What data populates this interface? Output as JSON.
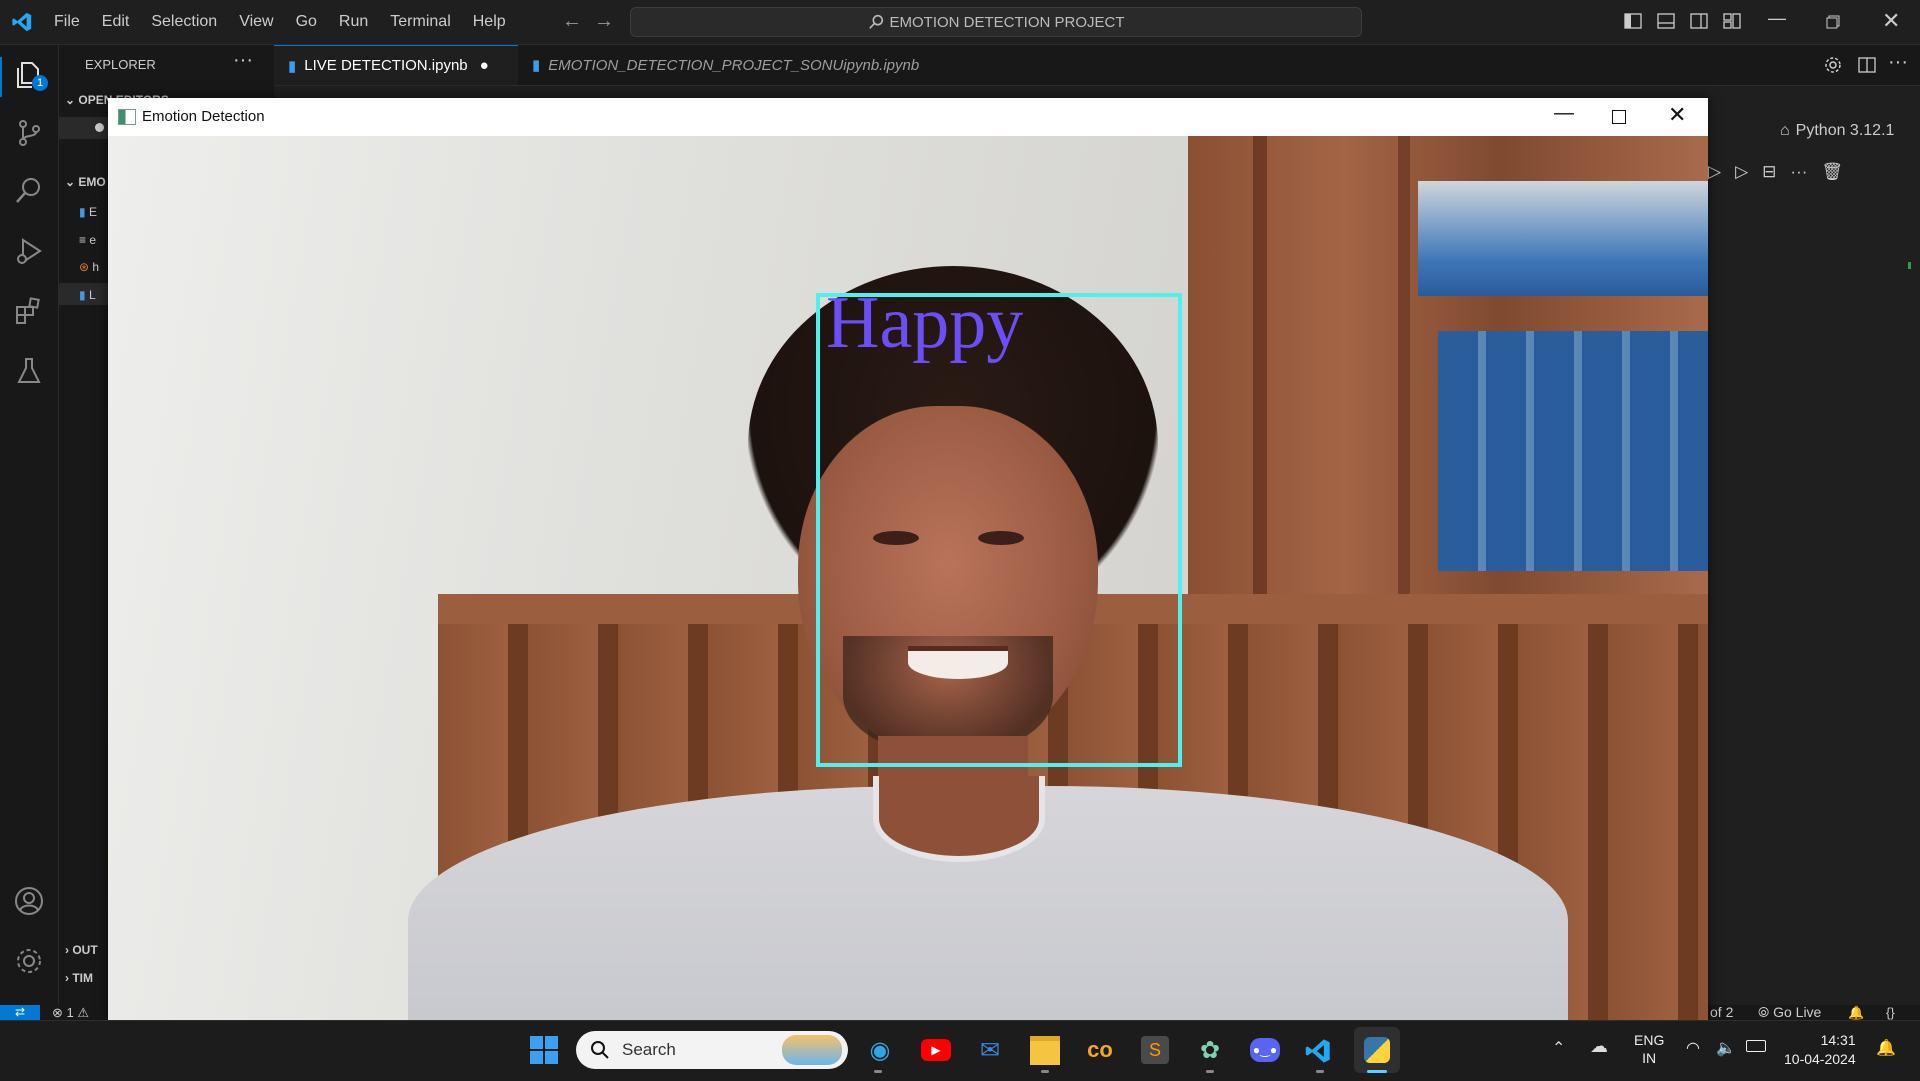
{
  "menu": {
    "file": "File",
    "edit": "Edit",
    "selection": "Selection",
    "view": "View",
    "go": "Go",
    "run": "Run",
    "terminal": "Terminal",
    "help": "Help"
  },
  "command_center": {
    "label": "EMOTION DETECTION PROJECT"
  },
  "activity": {
    "explorer_badge": "1"
  },
  "sidebar": {
    "title": "EXPLORER",
    "open_editors": "OPEN EDITORS",
    "project_section": "EMO",
    "outline": "OUT",
    "timeline": "TIM",
    "files": [
      {
        "initial": "E"
      },
      {
        "initial": "e"
      },
      {
        "initial": "h"
      },
      {
        "initial": "L"
      }
    ]
  },
  "tabs": [
    {
      "label": "LIVE DETECTION.ipynb",
      "dirty": "●"
    },
    {
      "label": "EMOTION_DETECTION_PROJECT_SONUipynb.ipynb"
    }
  ],
  "editor": {
    "kernel": "Python 3.12.1"
  },
  "popup": {
    "title": "Emotion Detection",
    "detection_label": "Happy",
    "box_color": "#4ff0ee",
    "label_color": "#6a4ff7"
  },
  "statusbar": {
    "errors": "1",
    "page_info": "of 2",
    "go_live": "Go Live"
  },
  "taskbar": {
    "search_placeholder": "Search",
    "lang1": "ENG",
    "lang2": "IN",
    "time": "14:31",
    "date": "10-04-2024"
  },
  "colors": {
    "accent": "#0078d4",
    "vscode_blue": "#23a9f2"
  }
}
